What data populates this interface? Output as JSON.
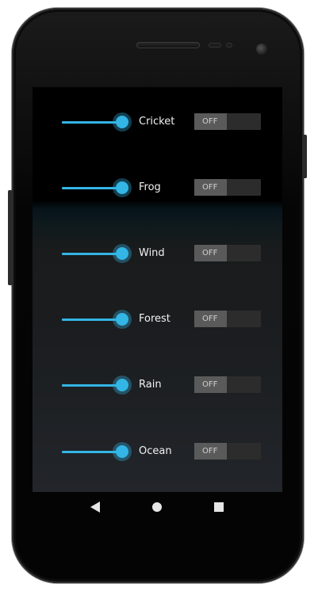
{
  "sounds": [
    {
      "name": "Cricket",
      "toggle": "OFF",
      "volume": 0.75
    },
    {
      "name": "Frog",
      "toggle": "OFF",
      "volume": 0.75
    },
    {
      "name": "Wind",
      "toggle": "OFF",
      "volume": 0.75
    },
    {
      "name": "Forest",
      "toggle": "OFF",
      "volume": 0.75
    },
    {
      "name": "Rain",
      "toggle": "OFF",
      "volume": 0.75
    },
    {
      "name": "Ocean",
      "toggle": "OFF",
      "volume": 0.75
    }
  ],
  "colors": {
    "accent": "#33b5e5",
    "toggle_track": "#2c2c2c",
    "toggle_knob": "#5a5a5a",
    "text": "#f2f2f2"
  },
  "navbar": {
    "back_icon": "back-triangle",
    "home_icon": "home-circle",
    "recents_icon": "recents-square"
  }
}
